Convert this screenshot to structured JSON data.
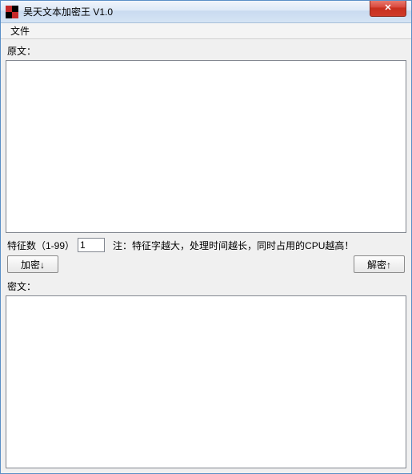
{
  "window": {
    "title": "昊天文本加密王 V1.0"
  },
  "menu": {
    "file": "文件"
  },
  "plaintext": {
    "label": "原文：",
    "value": ""
  },
  "feature": {
    "label_prefix": "特征数（1-99）",
    "value": "1",
    "note": "注：特征字越大，处理时间越长，同时占用的CPU越高！"
  },
  "buttons": {
    "encrypt": "加密↓",
    "decrypt": "解密↑"
  },
  "ciphertext": {
    "label": "密文：",
    "value": ""
  }
}
